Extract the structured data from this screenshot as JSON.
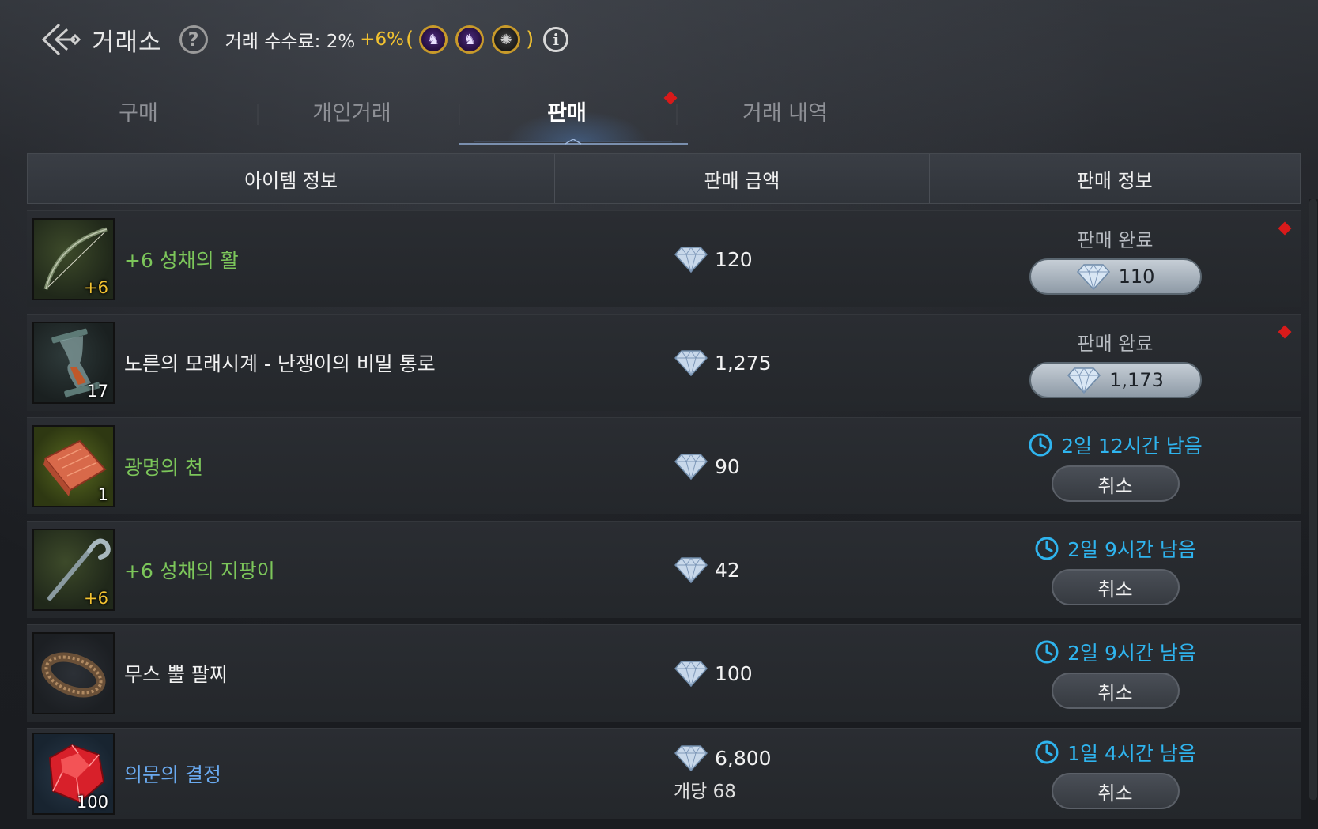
{
  "header": {
    "title": "거래소",
    "fee_label": "거래 수수료: 2%",
    "fee_bonus": "+6%",
    "paren_open": "(",
    "paren_close": ")",
    "buff_icons": [
      "buff-mount-icon",
      "buff-mount-icon",
      "buff-gear-icon"
    ]
  },
  "tabs": [
    {
      "label": "구매",
      "active": false
    },
    {
      "label": "개인거래",
      "active": false
    },
    {
      "label": "판매",
      "active": true
    },
    {
      "label": "거래 내역",
      "active": false
    }
  ],
  "table": {
    "headers": [
      "아이템 정보",
      "판매 금액",
      "판매 정보"
    ],
    "rows": [
      {
        "name": "+6 성채의 활",
        "name_color": "green",
        "badge": "+6",
        "icon": "bow-icon",
        "price": "120",
        "per_unit": "",
        "status": "completed",
        "status_label": "판매 완료",
        "claim_amount": "110",
        "has_alert": true
      },
      {
        "name": "노른의 모래시계 - 난쟁이의 비밀 통로",
        "name_color": "white",
        "badge": "17",
        "icon": "hourglass-icon",
        "price": "1,275",
        "per_unit": "",
        "status": "completed",
        "status_label": "판매 완료",
        "claim_amount": "1,173",
        "has_alert": true
      },
      {
        "name": "광명의 천",
        "name_color": "green",
        "badge": "1",
        "icon": "cloth-icon",
        "price": "90",
        "per_unit": "",
        "status": "listed",
        "time_left": "2일 12시간 남음",
        "cancel_label": "취소",
        "has_alert": false
      },
      {
        "name": "+6 성채의 지팡이",
        "name_color": "green",
        "badge": "+6",
        "icon": "staff-icon",
        "price": "42",
        "per_unit": "",
        "status": "listed",
        "time_left": "2일 9시간 남음",
        "cancel_label": "취소",
        "has_alert": false
      },
      {
        "name": "무스 뿔 팔찌",
        "name_color": "white",
        "badge": "",
        "icon": "bracelet-icon",
        "price": "100",
        "per_unit": "",
        "status": "listed",
        "time_left": "2일 9시간 남음",
        "cancel_label": "취소",
        "has_alert": false
      },
      {
        "name": "의문의 결정",
        "name_color": "blue",
        "badge": "100",
        "icon": "crystal-icon",
        "price": "6,800",
        "per_unit": "개당 68",
        "status": "listed",
        "time_left": "1일 4시간 남음",
        "cancel_label": "취소",
        "has_alert": false
      }
    ]
  },
  "colors": {
    "name_green": "#7cc65a",
    "name_blue": "#6aaaf0",
    "time_blue": "#2fb4ee",
    "fee_gold": "#f2c230",
    "alert_red": "#d81a1a"
  }
}
